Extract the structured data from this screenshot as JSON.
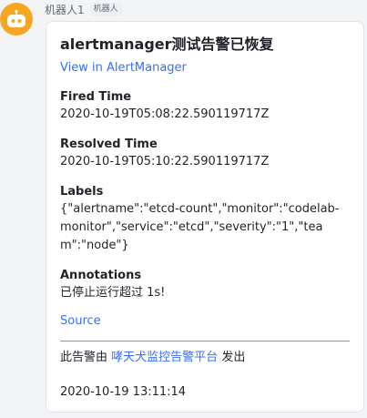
{
  "sender": {
    "name": "机器人1",
    "tag": "机器人",
    "avatar_color": "#f5a623",
    "avatar_icon": "robot-icon"
  },
  "card": {
    "title": "alertmanager测试告警已恢复",
    "view_link": "View in AlertManager",
    "sections": [
      {
        "label": "Fired Time",
        "value": "2020-10-19T05:08:22.590119717Z"
      },
      {
        "label": "Resolved Time",
        "value": "2020-10-19T05:10:22.590119717Z"
      },
      {
        "label": "Labels",
        "value": "{\"alertname\":\"etcd-count\",\"monitor\":\"codelab-monitor\",\"service\":\"etcd\",\"severity\":\"1\",\"team\":\"node\"}"
      },
      {
        "label": "Annotations",
        "value": "已停止运行超过 1s!"
      }
    ],
    "source_link": "Source",
    "footer": {
      "prefix": "此告警由",
      "platform_link": "哮天犬监控告警平台",
      "suffix": "发出"
    },
    "timestamp": "2020-10-19 13:11:14"
  },
  "colors": {
    "link": "#3370ff",
    "text": "#1f2329",
    "card_border": "#dfe3e8",
    "background": "#f3f4f6"
  }
}
